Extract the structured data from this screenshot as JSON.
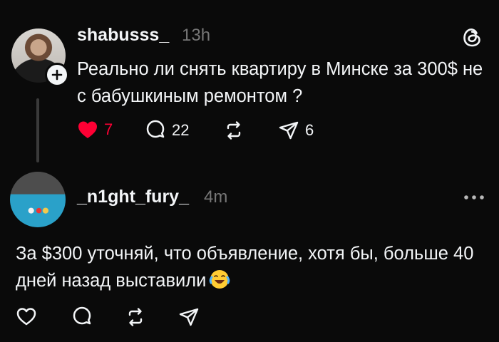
{
  "post1": {
    "username": "shabusss_",
    "time": "13h",
    "text": "Реально ли снять квартиру в Минске за 300$ не с бабушкиным ремонтом ?",
    "likes": "7",
    "replies": "22",
    "shares": "6",
    "liked": true
  },
  "post2": {
    "username": "_n1ght_fury_",
    "time": "4m",
    "text": "За $300 уточняй, что объявление, хотя бы, больше 40 дней назад выставили",
    "emoji": "face-with-tears-of-joy"
  },
  "colors": {
    "background": "#0a0a0a",
    "text": "#f3f5f7",
    "muted": "#777777",
    "like": "#fe0034",
    "thread_line": "#3a3a3a"
  },
  "icons": {
    "follow": "plus-icon",
    "logo": "threads-logo-icon",
    "like": "heart-icon",
    "reply": "comment-icon",
    "repost": "repost-icon",
    "share": "send-icon",
    "more": "more-dots-icon"
  }
}
